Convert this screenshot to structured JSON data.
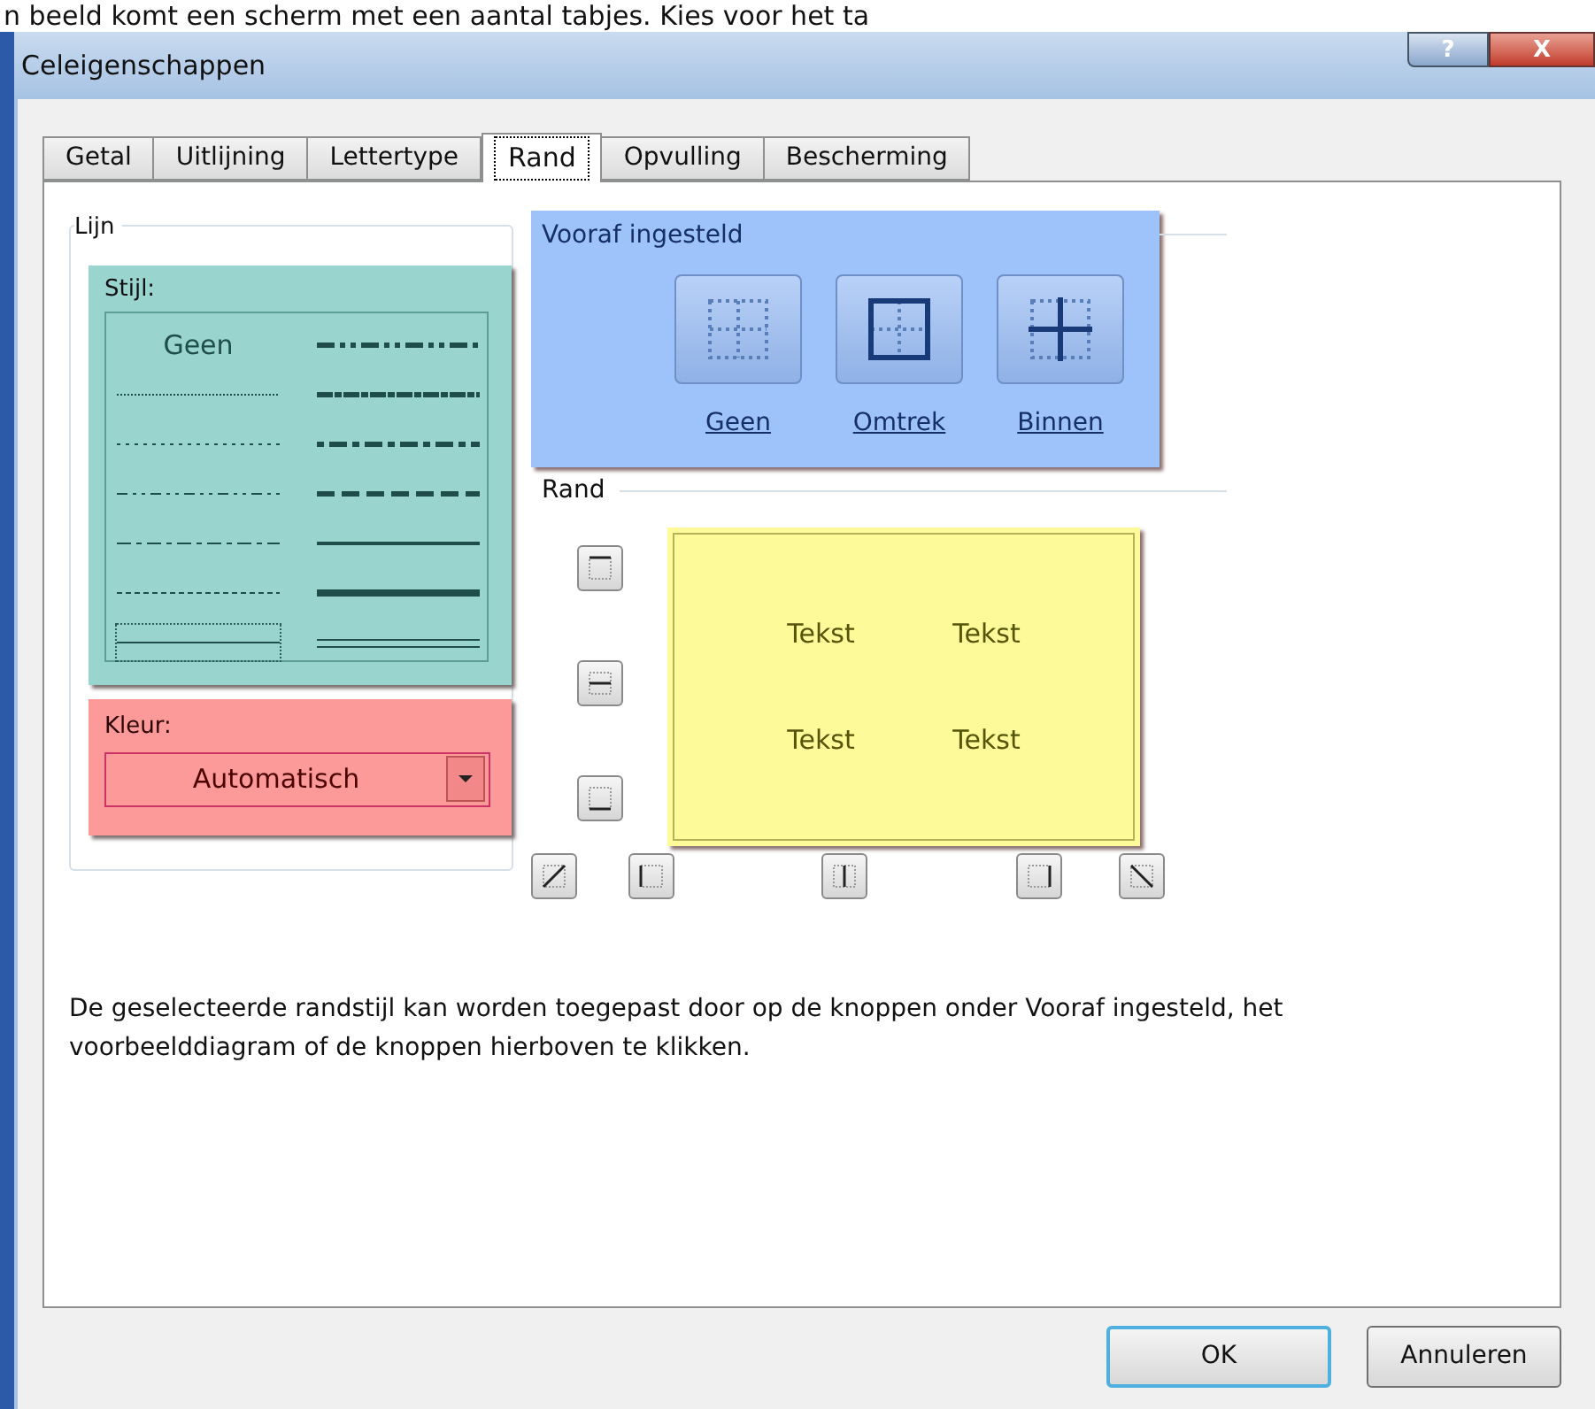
{
  "caption": "n beeld komt een scherm met een aantal tabjes. Kies voor het ta",
  "window": {
    "title": "Celeigenschappen",
    "help_button": "?",
    "close_button": "X"
  },
  "tabs": [
    {
      "label": "Getal",
      "selected": false
    },
    {
      "label": "Uitlijning",
      "selected": false
    },
    {
      "label": "Lettertype",
      "selected": false
    },
    {
      "label": "Rand",
      "selected": true
    },
    {
      "label": "Opvulling",
      "selected": false
    },
    {
      "label": "Bescherming",
      "selected": false
    }
  ],
  "line": {
    "group_title": "Lijn",
    "style_label": "Stijl:",
    "styles": [
      {
        "kind": "none",
        "label": "Geen",
        "selected": false
      },
      {
        "kind": "dash-dot-dot-medium",
        "selected": false
      },
      {
        "kind": "hair",
        "selected": false
      },
      {
        "kind": "slanted-dash-dot",
        "selected": false
      },
      {
        "kind": "dotted",
        "selected": false
      },
      {
        "kind": "dash-dot-medium",
        "selected": false
      },
      {
        "kind": "dash-dot-dot",
        "selected": false
      },
      {
        "kind": "dashed-medium",
        "selected": false
      },
      {
        "kind": "dash-dot",
        "selected": false
      },
      {
        "kind": "solid-medium",
        "selected": false
      },
      {
        "kind": "dashed",
        "selected": false
      },
      {
        "kind": "solid-thick",
        "selected": false
      },
      {
        "kind": "solid-thin",
        "selected": true
      },
      {
        "kind": "double",
        "selected": false
      }
    ],
    "color_label": "Kleur:",
    "color_value": "Automatisch"
  },
  "presets": {
    "title": "Vooraf ingesteld",
    "items": [
      {
        "kind": "none",
        "label": "Geen"
      },
      {
        "kind": "outline",
        "label": "Omtrek"
      },
      {
        "kind": "inside",
        "label": "Binnen"
      }
    ]
  },
  "border": {
    "title": "Rand",
    "preview_texts": [
      "Tekst",
      "Tekst",
      "Tekst",
      "Tekst"
    ]
  },
  "description": "De geselecteerde randstijl kan worden toegepast door op de knoppen onder Vooraf ingesteld, het voorbeelddiagram of de knoppen hierboven te klikken.",
  "buttons": [
    "OK",
    "Annuleren"
  ]
}
